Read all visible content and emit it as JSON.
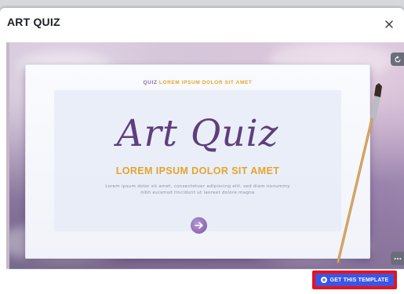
{
  "modal": {
    "title": "ART QUIZ",
    "close_icon": "close-icon"
  },
  "preview": {
    "kicker_part1": "QUIZ",
    "kicker_part2": "LOREM IPSUM DOLOR SIT AMET",
    "big_title": "Art Quiz",
    "subtitle": "LOREM IPSUM DOLOR SIT AMET",
    "body_line1": "Lorem ipsum dolor sit amet, consectetuer adipiscing elit, sed diam nonummy",
    "body_line2": "nibh euismod tincidunt ut laoreet dolore magna",
    "next_icon": "arrow-right-icon",
    "reload_icon": "reload-icon",
    "more_icon": "more-horizontal-icon"
  },
  "footer": {
    "cta_label": "GET THIS TEMPLATE",
    "cta_icon": "plus-circle-icon"
  },
  "colors": {
    "accent_blue": "#3b56e6",
    "highlight_red": "#e8121b",
    "title_purple": "#5e3f7c",
    "gold": "#e4a52b"
  }
}
